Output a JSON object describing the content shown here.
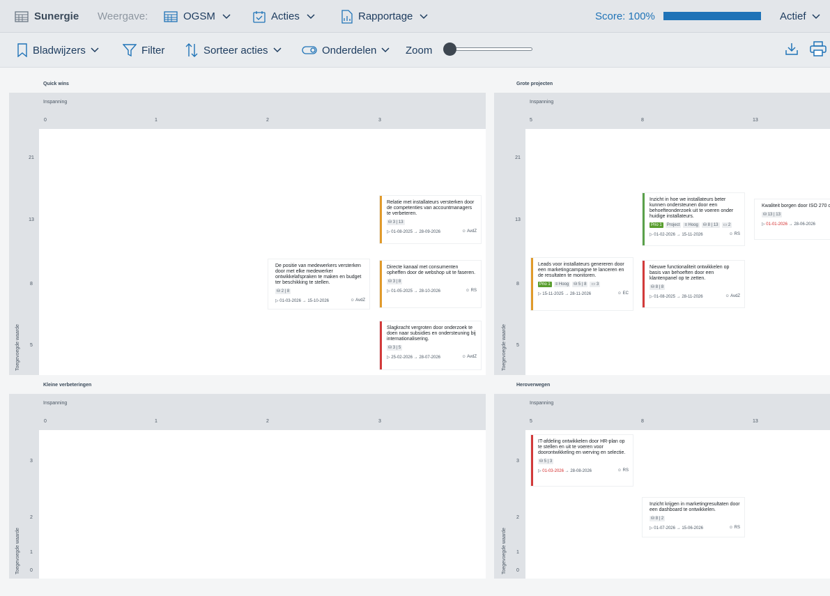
{
  "nav": {
    "brand": "Sunergie",
    "view_label": "Weergave:",
    "ogsm": "OGSM",
    "acties": "Acties",
    "rapportage": "Rapportage",
    "score_label": "Score: 100%",
    "score_fraction": 1.0,
    "status": "Actief"
  },
  "toolbar": {
    "bookmarks": "Bladwijzers",
    "filter": "Filter",
    "sort": "Sorteer acties",
    "parts": "Onderdelen",
    "zoom": "Zoom",
    "zoom_level": 0
  },
  "colors": {
    "accent": "#1f73b7",
    "orange": "#e09a2b",
    "green": "#5aa04a",
    "red": "#d23a3a"
  },
  "quadrants": {
    "q1": {
      "title": "Quick wins",
      "x_label": "Inspanning",
      "y_label": "Toegevoegde waarde",
      "x_ticks": [
        "0",
        "1",
        "2",
        "3"
      ],
      "y_ticks": [
        "21",
        "13",
        "8",
        "5"
      ]
    },
    "q2": {
      "title": "Grote projecten",
      "x_label": "Inspanning",
      "y_label": "Toegevoegde waarde",
      "x_ticks": [
        "5",
        "8",
        "13"
      ],
      "y_ticks": [
        "21",
        "13",
        "8",
        "5"
      ]
    },
    "q3": {
      "title": "Kleine verbeteringen",
      "x_label": "Inspanning",
      "y_label": "Toegevoegde waarde",
      "x_ticks": [
        "0",
        "1",
        "2",
        "3"
      ],
      "y_ticks": [
        "3",
        "2",
        "1",
        "0"
      ]
    },
    "q4": {
      "title": "Heroverwegen",
      "x_label": "Inspanning",
      "y_label": "Toegevoegde waarde",
      "x_ticks": [
        "5",
        "8",
        "13"
      ],
      "y_ticks": [
        "3",
        "2",
        "1",
        "0"
      ]
    }
  },
  "cards": {
    "c1": {
      "title": "Relatie met installateurs versterken door de competenties van accountmanagers te verbeteren.",
      "score": "3 | 13",
      "start": "01-08-2025",
      "end": "28-09-2026",
      "owner": "AvdZ"
    },
    "c2": {
      "title": "De positie van medewerkers versterken door met elke medewerker ontwikkelafspraken te maken en budget ter beschikking te stellen.",
      "score": "2 | 8",
      "start": "01-03-2026",
      "end": "15-10-2026",
      "owner": "AvdZ"
    },
    "c3": {
      "title": "Directe kanaal met consumenten opheffen door de webshop uit te faseren.",
      "score": "3 | 8",
      "start": "01-05-2025",
      "end": "28-10-2026",
      "owner": "RS"
    },
    "c4": {
      "title": "Slagkracht vergroten door onderzoek te doen naar subsidies en ondersteuning bij internationalisering.",
      "score": "3 | 5",
      "start": "25-02-2026",
      "end": "28-07-2026",
      "owner": "AvdZ"
    },
    "c5": {
      "title": "Inzicht in hoe we installateurs beter kunnen ondersteunen door een behoefteonderzoek uit te voeren onder huidige installateurs.",
      "prio": "Prio 1",
      "kind": "Project",
      "level": "Hoog",
      "score": "8 | 13",
      "count": "2",
      "start": "01-02-2026",
      "end": "15-11-2026",
      "owner": "RS"
    },
    "c6": {
      "title": "Kwaliteit borgen door ISO 270 certificering te organiseren.",
      "score": "13 | 13",
      "start": "01-01-2026",
      "end": "28-06-2026"
    },
    "c7": {
      "title": "Leads voor installateurs genereren door een marketingcampagne te lanceren en de resultaten te monitoren.",
      "prio": "Prio 1",
      "level": "Hoog",
      "score": "5 | 8",
      "count": "3",
      "start": "15-11-2025",
      "end": "28-11-2026",
      "owner": "EC"
    },
    "c8": {
      "title": "Nieuwe functionaliteit ontwikkelen op basis van behoeften door een klantenpanel op te zetten.",
      "score": "8 | 8",
      "start": "01-08-2025",
      "end": "28-11-2026",
      "owner": "AvdZ"
    },
    "c9": {
      "title": "IT-afdeling ontwikkelen door HR-plan op te stellen en uit te voeren voor doorontwikkeling en werving en selectie.",
      "score": "5 | 3",
      "start": "01-03-2026",
      "end": "28-08-2026",
      "owner": "RS"
    },
    "c10": {
      "title": "Inzicht krijgen in marketingresultaten door een dashboard te ontwikkelen.",
      "score": "8 | 2",
      "start": "01-07-2026",
      "end": "15-06-2026",
      "owner": "RS"
    }
  }
}
